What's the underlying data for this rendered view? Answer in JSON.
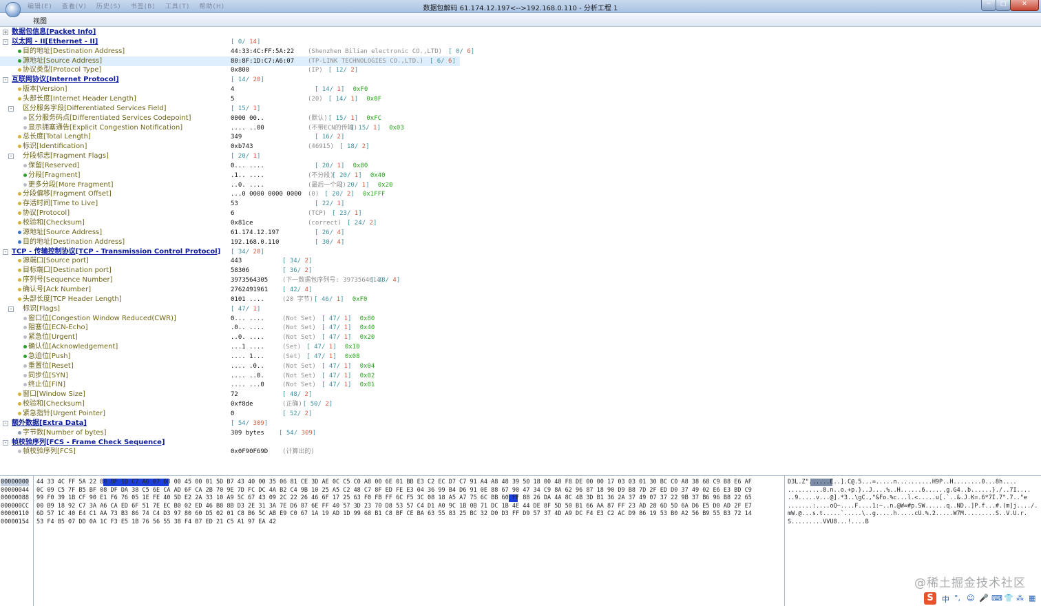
{
  "window": {
    "title": "数据包解码    61.174.12.197<-->192.168.0.110 - 分析工程 1",
    "bg_menu": [
      "编辑(E)",
      "查看(V)",
      "历史(S)",
      "书签(B)",
      "工具(T)",
      "帮助(H)"
    ],
    "minimize": "─",
    "maximize": "□",
    "close": "✕"
  },
  "menubar": {
    "view": "视图"
  },
  "tree": [
    {
      "label": "数据包信息[Packet Info]",
      "section": true,
      "expander": "+",
      "indent": 0
    },
    {
      "label": "以太网 - II[Ethernet - II]",
      "section": true,
      "expander": "-",
      "indent": 0,
      "off": "0",
      "len": "14"
    },
    {
      "label": "目的地址[Destination Address]",
      "indent": 1,
      "dot": "#2c9e2c",
      "value": "44:33:4C:FF:5A:22",
      "desc": "(Shenzhen Bilian electronic CO.,LTD)",
      "off": "0",
      "len": "6"
    },
    {
      "label": "源地址[Source Address]",
      "indent": 1,
      "dot": "#2c9e2c",
      "value": "80:8F:1D:C7:A6:07",
      "desc": "(TP-LINK TECHNOLOGIES CO.,LTD.)",
      "off": "6",
      "len": "6",
      "selected": true
    },
    {
      "label": "协议类型[Protocol Type]",
      "indent": 1,
      "dot": "#d1b23a",
      "value": "0x800",
      "desc": "(IP)",
      "off": "12",
      "len": "2"
    },
    {
      "label": "互联网协议[Internet Protocol]",
      "section": true,
      "expander": "-",
      "indent": 0,
      "off": "14",
      "len": "20"
    },
    {
      "label": "版本[Version]",
      "indent": 1,
      "dot": "#d1b23a",
      "value": "4",
      "off": "14",
      "len": "1",
      "bits": "0xF0"
    },
    {
      "label": "头部长度[Internet Header Length]",
      "indent": 1,
      "dot": "#d1b23a",
      "value": "5",
      "desc": "(20)",
      "off": "14",
      "len": "1",
      "bits": "0x0F"
    },
    {
      "label": "区分服务字段[Differentiated Services Field]",
      "indent": 1,
      "expander": "-",
      "value": "",
      "off": "15",
      "len": "1"
    },
    {
      "label": "区分服务码点[Differentiated Services Codepoint]",
      "indent": 2,
      "dot": "#b9bcc4",
      "value": "0000 00..",
      "desc": "(默认)",
      "off": "15",
      "len": "1",
      "bits": "0xFC"
    },
    {
      "label": "显示拥塞通告[Explicit Congestion Notification]",
      "indent": 2,
      "dot": "#b9bcc4",
      "value": ".... ..00",
      "desc": "(不带ECN的传输)",
      "off": "15",
      "len": "1",
      "bits": "0x03"
    },
    {
      "label": "总长度[Total Length]",
      "indent": 1,
      "dot": "#d1b23a",
      "value": "349",
      "off": "16",
      "len": "2"
    },
    {
      "label": "标识[Identification]",
      "indent": 1,
      "dot": "#d1b23a",
      "value": "0xb743",
      "desc": "(46915)",
      "off": "18",
      "len": "2"
    },
    {
      "label": "分段标志[Fragment Flags]",
      "indent": 1,
      "expander": "-",
      "value": "",
      "off": "20",
      "len": "1"
    },
    {
      "label": "保留[Reserved]",
      "indent": 2,
      "dot": "#b9bcc4",
      "value": "0... ....",
      "off": "20",
      "len": "1",
      "bits": "0x80"
    },
    {
      "label": "分段[Fragment]",
      "indent": 2,
      "dot": "#2c9e2c",
      "value": ".1.. ....",
      "desc": "(不分段)",
      "off": "20",
      "len": "1",
      "bits": "0x40"
    },
    {
      "label": "更多分段[More Fragment]",
      "indent": 2,
      "dot": "#b9bcc4",
      "value": "..0. ....",
      "desc": "(最后一个段)",
      "off": "20",
      "len": "1",
      "bits": "0x20"
    },
    {
      "label": "分段偏移[Fragment Offset]",
      "indent": 1,
      "dot": "#d1b23a",
      "value": "...0 0000 0000 0000",
      "desc": "(0)",
      "off": "20",
      "len": "2",
      "bits": "0x1FFF"
    },
    {
      "label": "存活时间[Time to Live]",
      "indent": 1,
      "dot": "#d1b23a",
      "value": "53",
      "off": "22",
      "len": "1"
    },
    {
      "label": "协议[Protocol]",
      "indent": 1,
      "dot": "#d1b23a",
      "value": "6",
      "desc": "(TCP)",
      "off": "23",
      "len": "1"
    },
    {
      "label": "校验和[Checksum]",
      "indent": 1,
      "dot": "#d1b23a",
      "value": "0x81ce",
      "desc": "(correct)",
      "off": "24",
      "len": "2"
    },
    {
      "label": "源地址[Source Address]",
      "indent": 1,
      "dot": "#3a74c9",
      "value": "61.174.12.197",
      "off": "26",
      "len": "4"
    },
    {
      "label": "目的地址[Destination Address]",
      "indent": 1,
      "dot": "#3a74c9",
      "value": "192.168.0.110",
      "off": "30",
      "len": "4"
    },
    {
      "label": "TCP - 传输控制协议[TCP - Transmission Control Protocol]",
      "section": true,
      "expander": "-",
      "indent": 0,
      "off": "34",
      "len": "20"
    },
    {
      "label": "源端口[Source port]",
      "indent": 1,
      "dot": "#d1b23a",
      "value": "443",
      "off": "34",
      "len": "2",
      "col": 2
    },
    {
      "label": "目标端口[Destination port]",
      "indent": 1,
      "dot": "#d1b23a",
      "value": "58306",
      "off": "36",
      "len": "2",
      "col": 2
    },
    {
      "label": "序列号[Sequence Number]",
      "indent": 1,
      "dot": "#d1b23a",
      "value": "3973564305",
      "desc": "(下一数据包序列号: 3973564614)",
      "off": "38",
      "len": "4",
      "col": 2
    },
    {
      "label": "确认号[Ack Number]",
      "indent": 1,
      "dot": "#d1b23a",
      "value": "2762491961",
      "off": "42",
      "len": "4",
      "col": 2
    },
    {
      "label": "头部长度[TCP Header Length]",
      "indent": 1,
      "dot": "#d1b23a",
      "value": "0101 ....",
      "desc": "(20 字节)",
      "off": "46",
      "len": "1",
      "bits": "0xF0",
      "col": 2
    },
    {
      "label": "标识[Flags]",
      "indent": 1,
      "expander": "-",
      "value": "",
      "off": "47",
      "len": "1"
    },
    {
      "label": "窗口位[Congestion Window Reduced(CWR)]",
      "indent": 2,
      "dot": "#b9bcc4",
      "value": "0... ....",
      "desc": "(Not Set)",
      "off": "47",
      "len": "1",
      "bits": "0x80",
      "col": 2
    },
    {
      "label": "阻塞位[ECN-Echo]",
      "indent": 2,
      "dot": "#b9bcc4",
      "value": ".0.. ....",
      "desc": "(Not Set)",
      "off": "47",
      "len": "1",
      "bits": "0x40",
      "col": 2
    },
    {
      "label": "紧急位[Urgent]",
      "indent": 2,
      "dot": "#b9bcc4",
      "value": "..0. ....",
      "desc": "(Not Set)",
      "off": "47",
      "len": "1",
      "bits": "0x20",
      "col": 2
    },
    {
      "label": "确认位[Acknowledgement]",
      "indent": 2,
      "dot": "#2c9e2c",
      "value": "...1 ....",
      "desc": "(Set)",
      "off": "47",
      "len": "1",
      "bits": "0x10",
      "col": 2
    },
    {
      "label": "急迫位[Push]",
      "indent": 2,
      "dot": "#2c9e2c",
      "value": ".... 1...",
      "desc": "(Set)",
      "off": "47",
      "len": "1",
      "bits": "0x08",
      "col": 2
    },
    {
      "label": "重置位[Reset]",
      "indent": 2,
      "dot": "#b9bcc4",
      "value": ".... .0..",
      "desc": "(Not Set)",
      "off": "47",
      "len": "1",
      "bits": "0x04",
      "col": 2
    },
    {
      "label": "同步位[SYN]",
      "indent": 2,
      "dot": "#b9bcc4",
      "value": ".... ..0.",
      "desc": "(Not Set)",
      "off": "47",
      "len": "1",
      "bits": "0x02",
      "col": 2
    },
    {
      "label": "终止位[FIN]",
      "indent": 2,
      "dot": "#b9bcc4",
      "value": ".... ...0",
      "desc": "(Not Set)",
      "off": "47",
      "len": "1",
      "bits": "0x01",
      "col": 2
    },
    {
      "label": "窗口[Window Size]",
      "indent": 1,
      "dot": "#d1b23a",
      "value": "72",
      "off": "48",
      "len": "2",
      "col": 2
    },
    {
      "label": "校验和[Checksum]",
      "indent": 1,
      "dot": "#d1b23a",
      "value": "0xf8de",
      "desc": "(正确)",
      "off": "50",
      "len": "2",
      "col": 2
    },
    {
      "label": "紧急指针[Urgent Pointer]",
      "indent": 1,
      "dot": "#d1b23a",
      "value": "0",
      "off": "52",
      "len": "2",
      "col": 2
    },
    {
      "label": "额外数据[Extra Data]",
      "section": true,
      "expander": "-",
      "indent": 0,
      "off": "54",
      "len": "309"
    },
    {
      "label": "字节数[Number of bytes]",
      "indent": 1,
      "dot": "#8c9bb4",
      "value": "309 bytes",
      "off": "54",
      "len": "309",
      "col": 3
    },
    {
      "label": "帧校验序列[FCS - Frame Check Sequence]",
      "section": true,
      "expander": "-",
      "indent": 0
    },
    {
      "label": "帧校验序列[FCS]",
      "indent": 1,
      "dot": "#b9bcc4",
      "value": "0x0F90F69D",
      "desc": "(计算出的)",
      "col": 2
    }
  ],
  "hex": {
    "addresses": [
      "00000000",
      "00000044",
      "00000088",
      "000000CC",
      "00000110",
      "00000154"
    ],
    "rows": [
      "44 33 4C FF 5A 22 80 8F 1D C7 A6 07 08 00 45 00 01 5D B7 43 40 00 35 06 81 CE 3D AE 0C C5 C0 A8 00 6E 01 BB E3 C2 EC D7 C7 91 A4 A8 48 39 50 18 00 48 F8 DE 00 00 17 03 03 01 30 BC C0 A8 38 68 C9 B8 E6 AF",
      "0C 09 C5 7F B5 BF 08 DF DA 38 C5 6E CA AD 6F CA 2B 70 9E 7D FC DC 4A B2 C4 9B 10 25 A5 C2 48 C7 8F ED FE E3 04 36 99 B4 D6 91 0E 88 67 90 47 34 C9 8A 62 96 87 18 90 D9 B8 7D 2F ED D0 37 49 02 E6 E3 BD C9",
      "99 F0 39 1B CF 90 E1 F6 76 05 1E FE 40 5D E2 2A 33 10 A9 5C 67 43 09 2C 22 26 46 6F 17 25 63 F0 FB FF 6C F5 3C 08 18 A5 A7 75 6C BB 60 FF 88 26 DA 4A 8C 4B 3D B1 36 2A 37 49 07 37 22 9B 37 B6 96 B8 22 65",
      "00 B9 18 92 C7 3A A6 CA ED 6F 51 7E EC B0 02 ED 46 B8 8B D3 2E 31 3A 7E D6 87 6E FF 40 57 3D 23 70 D8 53 57 C4 D1 A0 9C 1B 0B 71 DC 1B 4E 44 DE 8F 5D 50 B1 66 AA 87 FF 23 AD 28 6D 5D 6A D6 E5 D0 AD 2F E7",
      "6D 57 1C 40 E4 C1 AA 73 B3 86 74 C4 D3 97 80 60 D5 02 01 C8 B6 5C AB E9 C0 67 1A 19 AD 1D 99 68 B1 C8 BF CE BA 63 55 83 25 BC 32 D0 D3 FF D9 57 37 4D A9 DC F4 E3 C2 AC D9 86 19 53 B0 A2 56 B9 55 B3 72 14",
      "53 F4 85 07 DD 0A 1C F3 E5 1B 76 56 55 38 F4 B7 ED 21 C5 A1 97 EA 42"
    ],
    "ascii": [
      "D3L.Z\"......E..].C@.5...=.....n..........H9P..H........0...8h....",
      "..........8.n..o.+p.}..J....%..H......6......g.G4..b......}./..7I....",
      "..9.....v...@].*3..\\gC.,\"&Fo.%c...l.<.....u[.`..&.J.K=.6*7I.7\".7..\"e",
      ".......:....oQ~....F....1:~..n.@W=#p.SW......q..ND..]P.f...#.(m]j..../.",
      "mW.@...s.t.....`.....\\..g.....h.....cU.%.2.....W7M.........S..V.U.r.",
      "S.........VVU8...!....B"
    ]
  },
  "watermark": "@稀土掘金技术社区",
  "ime": {
    "logo": "S",
    "items": [
      "中",
      "°,",
      "☺",
      "🎤",
      "⌨",
      "👕",
      "⁂",
      "▦"
    ]
  }
}
